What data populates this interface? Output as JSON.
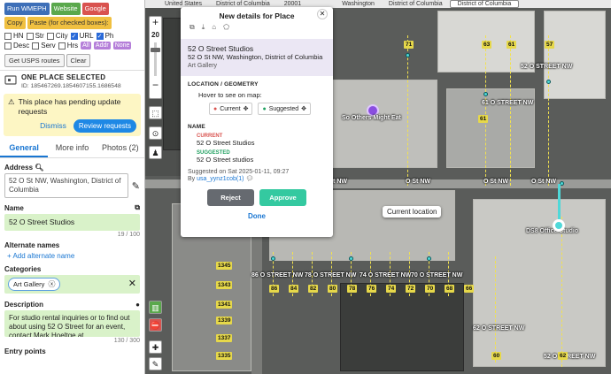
{
  "toolbar": {
    "run": "Run WMEPH",
    "website": "Website",
    "google": "Google",
    "copy_paste": "Copy",
    "paste_checked": "Paste (for checked boxes):"
  },
  "checkboxes": {
    "row1": [
      {
        "label": "HN",
        "checked": false
      },
      {
        "label": "Str",
        "checked": false
      },
      {
        "label": "City",
        "checked": false
      },
      {
        "label": "URL",
        "checked": true
      },
      {
        "label": "Ph",
        "checked": true
      }
    ],
    "row2": [
      {
        "label": "Desc",
        "checked": false
      },
      {
        "label": "Serv",
        "checked": false
      },
      {
        "label": "Hrs",
        "checked": false
      }
    ],
    "pills": [
      "All",
      "Addr",
      "None"
    ]
  },
  "usps": {
    "get": "Get USPS routes",
    "clear": "Clear"
  },
  "place": {
    "selected_title": "ONE PLACE SELECTED",
    "id": "ID: 185467269.1854607155.1686548"
  },
  "pending": {
    "text": "This place has pending update requests",
    "dismiss": "Dismiss",
    "review": "Review requests"
  },
  "tabs": [
    {
      "label": "General"
    },
    {
      "label": "More info"
    },
    {
      "label": "Photos (2)"
    }
  ],
  "address": {
    "label": "Address",
    "value": "52 O St NW, Washington, District of Columbia"
  },
  "name": {
    "label": "Name",
    "value": "52 O Street Studios",
    "counter": "19 / 100"
  },
  "alt_names": {
    "label": "Alternate names",
    "add": "+ Add alternate name"
  },
  "categories": {
    "label": "Categories",
    "chip": "Art Gallery"
  },
  "description": {
    "label": "Description",
    "value": "For studio rental inquiries or to find out about using 52 O Street for an event, contact Mark Hoeltge at",
    "counter": "130 / 300"
  },
  "entry_points": {
    "label": "Entry points"
  },
  "map": {
    "top_tabs": [
      "United States",
      "District of Columbia",
      "20001",
      "Washington",
      "District of Columbia",
      "District of Columbia"
    ],
    "zoom": "20",
    "street_labels": [
      "52 O STREET NW",
      "61 O STREET NW",
      "O St NW",
      "O St NW",
      "O St NW",
      "O St NW",
      "86 O STREET NW",
      "78 O STREET NW",
      "74 O STREET NW",
      "70 O STREET NW",
      "52 O STREET NW",
      "62 O STREET NW"
    ],
    "poi": "So Others Might Eat",
    "area_label": "DS8 Office/Studio",
    "house_numbers": [
      "71",
      "63",
      "61",
      "57",
      "86",
      "84",
      "82",
      "80",
      "78",
      "76",
      "74",
      "72",
      "70",
      "68",
      "66",
      "60",
      "1345",
      "1343",
      "1341",
      "1339",
      "1337",
      "1335",
      "62",
      "61"
    ],
    "current_location": "Current location"
  },
  "popup": {
    "title": "New details for Place",
    "place_name": "52 O Street Studios",
    "place_address": "52 O St NW, Washington, District of Columbia",
    "place_category": "Art Gallery",
    "loc_header": "LOCATION / GEOMETRY",
    "hover_text": "Hover to see on map:",
    "current_btn": "Current",
    "suggested_btn": "Suggested",
    "name_header": "NAME",
    "current_label": "CURRENT",
    "current_value": "52 O Street Studios",
    "suggested_label": "SUGGESTED",
    "suggested_value": "52 O Street studios",
    "suggested_on": "Suggested on Sat 2025-01-11, 09:27",
    "by_label": "By",
    "by_user": "usa_yynz1cob(1)",
    "reject": "Reject",
    "approve": "Approve",
    "done": "Done"
  },
  "colors": {
    "run": "#3d6fb8",
    "website": "#5aa84c",
    "google": "#d9534f",
    "copy": "#f0c040",
    "accent": "#1976d2",
    "reject": "#666a70",
    "approve": "#34c9a0"
  }
}
